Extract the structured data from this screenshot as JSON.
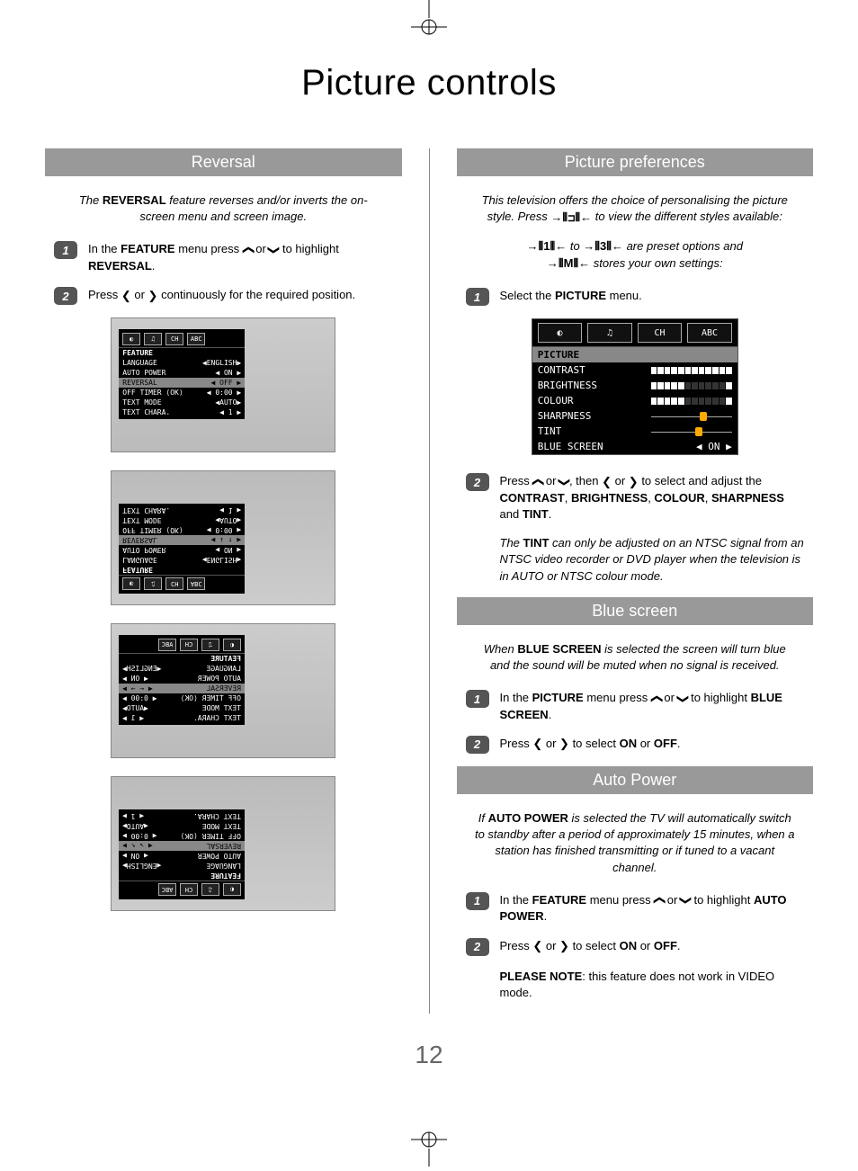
{
  "page_title": "Picture controls",
  "page_number": "12",
  "left": {
    "section1_title": "Reversal",
    "intro_a": "The ",
    "intro_bold": "REVERSAL",
    "intro_b": " feature reverses and/or inverts the on-screen menu and screen image.",
    "step1_a": "In the ",
    "step1_bold1": "FEATURE",
    "step1_b": " menu press ",
    "step1_c": " or ",
    "step1_d": " to highlight ",
    "step1_bold2": "REVERSAL",
    "step1_e": ".",
    "step2_a": "Press ",
    "step2_b": " or ",
    "step2_c": " continuously for the required position.",
    "osd": {
      "title": "FEATURE",
      "rows": [
        {
          "l": "LANGUAGE",
          "r": "◀ENGLISH▶"
        },
        {
          "l": "AUTO POWER",
          "r": "◀   ON   ▶"
        },
        {
          "l": "REVERSAL",
          "r": "◀  OFF  ▶",
          "hl": true
        },
        {
          "l": "OFF TIMER ⟨OK⟩",
          "r": "◀  0:00  ▶"
        },
        {
          "l": "TEXT MODE",
          "r": "◀AUTO▶"
        },
        {
          "l": "TEXT CHARA.",
          "r": "◀    1    ▶"
        }
      ],
      "reversal_alt": "◀ ↓ ↑ ▶",
      "reversal_alt2": "◀ ← → ▶",
      "reversal_alt3": "◀ ↘ ↖ ▶"
    }
  },
  "right": {
    "section1_title": "Picture preferences",
    "intro_a": "This television offers the choice of personalising the picture style. Press ",
    "intro_b": " to view the different styles available:",
    "preset_a": " to ",
    "preset_b": " are preset options and ",
    "preset_c": " stores your own settings:",
    "preset_icon1": "→⦀1⦀←",
    "preset_icon3": "→⦀3⦀←",
    "preset_iconM": "→⦀M⦀←",
    "picpref_icon": "→⦀⊐⦀←",
    "step1": "Select the ",
    "step1_bold": "PICTURE",
    "step1_b": " menu.",
    "osd": {
      "title": "PICTURE",
      "rows": [
        {
          "l": "CONTRAST",
          "type": "bar",
          "fill": 12
        },
        {
          "l": "BRIGHTNESS",
          "type": "bar",
          "fill": 5
        },
        {
          "l": "COLOUR",
          "type": "bar",
          "fill": 5
        },
        {
          "l": "SHARPNESS",
          "type": "slider",
          "pos": 65
        },
        {
          "l": "TINT",
          "type": "slider",
          "pos": 60
        },
        {
          "l": "BLUE SCREEN",
          "type": "val",
          "r": "◀   ON   ▶"
        }
      ]
    },
    "step2_a": "Press ",
    "step2_b": " or ",
    "step2_c": ", then ",
    "step2_d": " or ",
    "step2_e": " to select and adjust the ",
    "step2_bold1": "CONTRAST",
    "step2_bold2": "BRIGHTNESS",
    "step2_bold3": "COLOUR",
    "step2_bold4": "SHARPNESS",
    "step2_and": " and ",
    "step2_bold5": "TINT",
    "step2_f": ".",
    "note_a": "The ",
    "note_bold": "TINT",
    "note_b": " can only be adjusted on an NTSC signal from an NTSC video recorder or DVD player when the television is in AUTO or NTSC colour mode.",
    "section2_title": "Blue screen",
    "blue_intro_a": "When ",
    "blue_intro_bold": "BLUE SCREEN",
    "blue_intro_b": " is selected the screen will turn blue and the sound will be muted when no signal is received.",
    "blue_step1_a": "In the ",
    "blue_step1_bold1": "PICTURE",
    "blue_step1_b": " menu press ",
    "blue_step1_c": " or ",
    "blue_step1_d": " to highlight ",
    "blue_step1_bold2": "BLUE SCREEN",
    "blue_step1_e": ".",
    "blue_step2_a": "Press ",
    "blue_step2_b": " or ",
    "blue_step2_c": " to select ",
    "blue_step2_bold1": "ON",
    "blue_step2_or": " or ",
    "blue_step2_bold2": "OFF",
    "blue_step2_d": ".",
    "section3_title": "Auto Power",
    "auto_intro_a": "If ",
    "auto_intro_bold": "AUTO POWER",
    "auto_intro_b": " is selected the TV will automatically switch to standby after a period of approximately 15 minutes, when a station has finished transmitting or if tuned to a vacant channel.",
    "auto_step1_a": "In the ",
    "auto_step1_bold1": "FEATURE",
    "auto_step1_b": " menu press ",
    "auto_step1_c": " or ",
    "auto_step1_d": " to highlight ",
    "auto_step1_bold2": "AUTO POWER",
    "auto_step1_e": ".",
    "auto_step2_a": "Press ",
    "auto_step2_b": " or ",
    "auto_step2_c": " to select ",
    "auto_step2_bold1": "ON",
    "auto_step2_or": " or ",
    "auto_step2_bold2": "OFF",
    "auto_step2_d": ".",
    "please_note_bold": "PLEASE NOTE",
    "please_note": ": this feature does not work in VIDEO mode."
  },
  "arrows": {
    "up": "❯",
    "down": "❯",
    "left": "❮",
    "right": "❯"
  },
  "osd_tabs": [
    "◐",
    "♫",
    "CH",
    "ABC"
  ]
}
